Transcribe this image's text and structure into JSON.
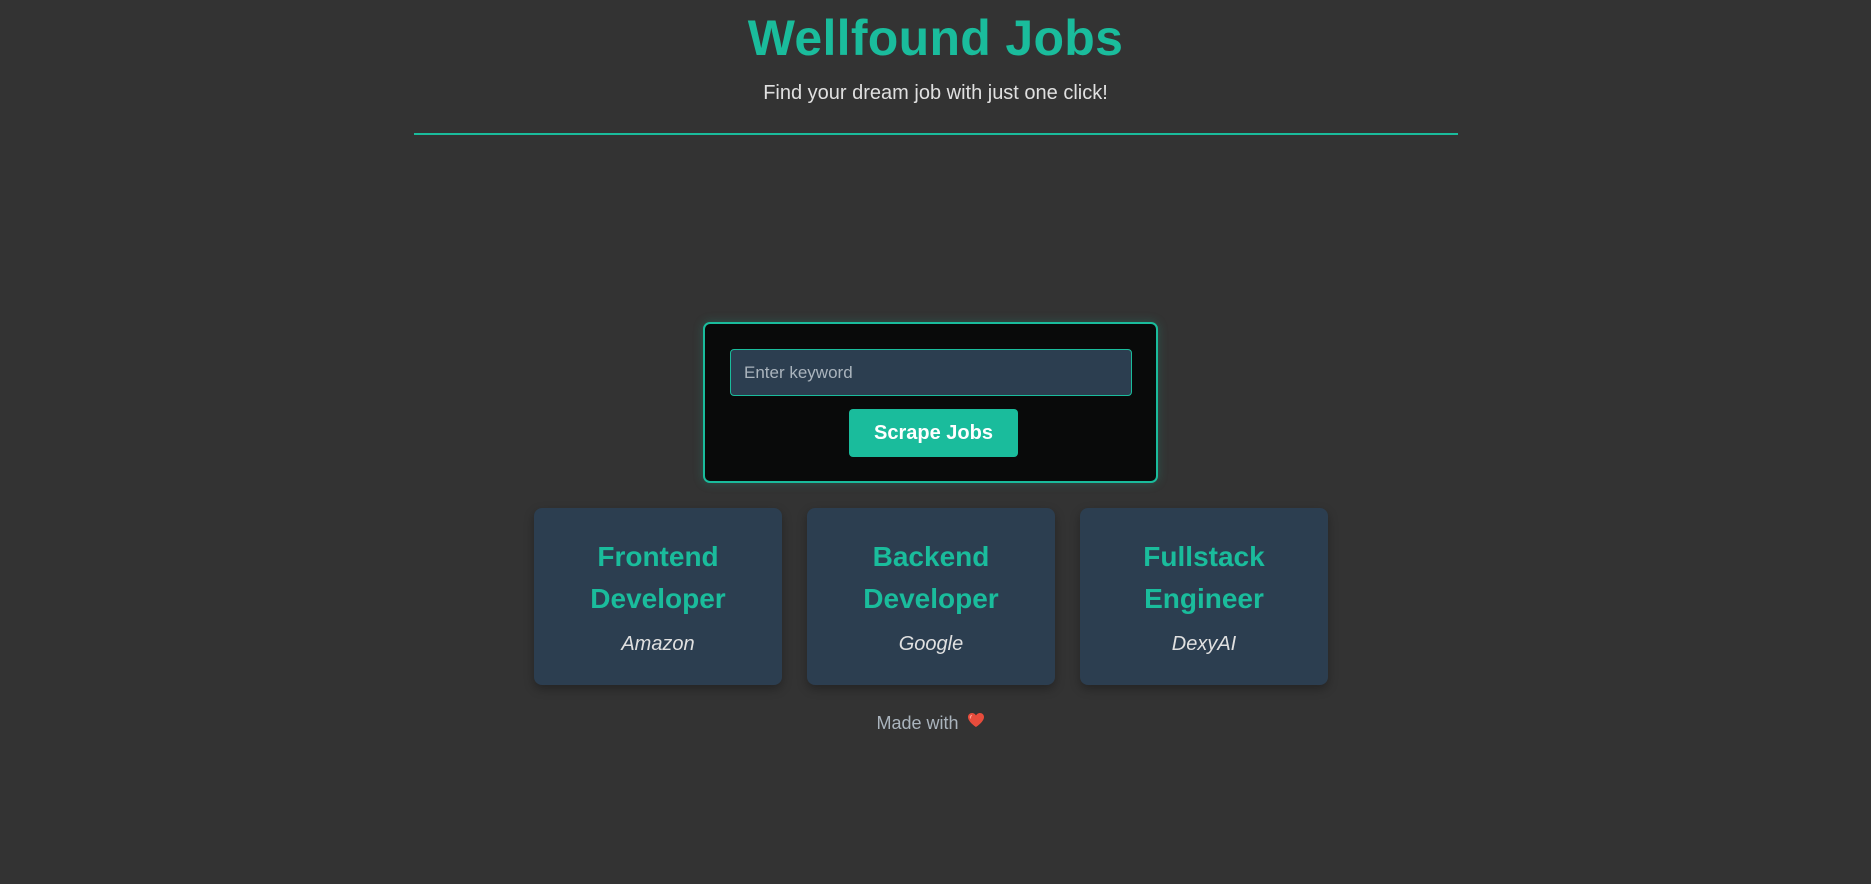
{
  "header": {
    "title": "Wellfound Jobs",
    "subtitle": "Find your dream job with just one click!"
  },
  "search": {
    "placeholder": "Enter keyword",
    "value": "",
    "button_label": "Scrape Jobs"
  },
  "jobs": [
    {
      "title": "Frontend Developer",
      "company": "Amazon"
    },
    {
      "title": "Backend Developer",
      "company": "Google"
    },
    {
      "title": "Fullstack Engineer",
      "company": "DexyAI"
    }
  ],
  "footer": {
    "text": "Made with",
    "icon": "heart-icon"
  },
  "colors": {
    "accent": "#1abc9c",
    "background": "#333333",
    "card": "#2c3e50",
    "heart": "#e74c3c"
  }
}
